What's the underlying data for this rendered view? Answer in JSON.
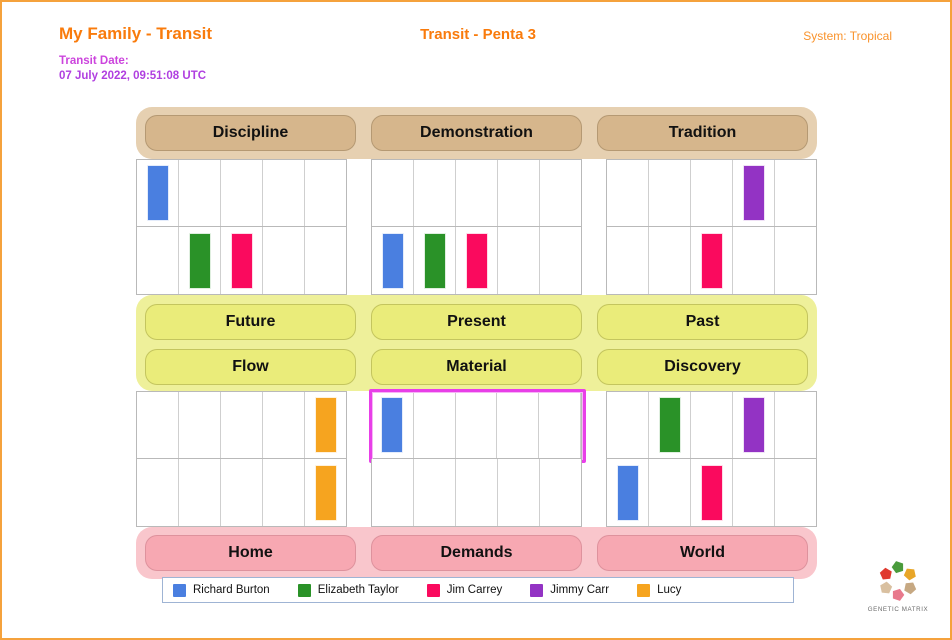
{
  "header": {
    "left_title": "My Family - Transit",
    "center_title": "Transit - Penta 3",
    "system_label": "System: Tropical",
    "transit_date_label": "Transit Date:",
    "transit_date_value": "07 July 2022, 09:51:08 UTC"
  },
  "bands": {
    "top": [
      "Discipline",
      "Demonstration",
      "Tradition"
    ],
    "middle_row1": [
      "Future",
      "Present",
      "Past"
    ],
    "middle_row2": [
      "Flow",
      "Material",
      "Discovery"
    ],
    "bottom": [
      "Home",
      "Demands",
      "World"
    ]
  },
  "people": [
    {
      "name": "Richard Burton",
      "color": "#4a7fe0"
    },
    {
      "name": "Elizabeth Taylor",
      "color": "#2a9228"
    },
    {
      "name": "Jim Carrey",
      "color": "#fa0a5e"
    },
    {
      "name": "Jimmy Carr",
      "color": "#9333c4"
    },
    {
      "name": "Lucy",
      "color": "#f6a41f"
    }
  ],
  "logo": {
    "caption": "GENETIC MATRIX",
    "petal_colors": [
      "#4a9b3c",
      "#e8a628",
      "#c6a882",
      "#e8798c",
      "#d9c0a0",
      "#e03a2f"
    ]
  },
  "chart_data": {
    "type": "bar",
    "title": "Transit - Penta 3",
    "groups": [
      "Discipline",
      "Demonstration",
      "Tradition"
    ],
    "columns_per_group": 5,
    "highlight": {
      "section": "lower",
      "row": 0,
      "group": 1
    },
    "rows": [
      {
        "section": "upper",
        "row": 0,
        "cells": [
          [
            "Richard Burton",
            null,
            null,
            null,
            null
          ],
          [
            null,
            null,
            null,
            null,
            null
          ],
          [
            null,
            null,
            null,
            "Jimmy Carr",
            null
          ]
        ]
      },
      {
        "section": "upper",
        "row": 1,
        "cells": [
          [
            null,
            "Elizabeth Taylor",
            "Jim Carrey",
            null,
            null
          ],
          [
            "Richard Burton",
            "Elizabeth Taylor",
            "Jim Carrey",
            null,
            null
          ],
          [
            null,
            null,
            "Jim Carrey",
            null,
            null
          ]
        ]
      },
      {
        "section": "lower",
        "row": 0,
        "cells": [
          [
            null,
            null,
            null,
            null,
            "Lucy"
          ],
          [
            "Richard Burton",
            null,
            null,
            null,
            null
          ],
          [
            null,
            "Elizabeth Taylor",
            null,
            "Jimmy Carr",
            null
          ]
        ]
      },
      {
        "section": "lower",
        "row": 1,
        "cells": [
          [
            null,
            null,
            null,
            null,
            "Lucy"
          ],
          [
            null,
            null,
            null,
            null,
            null
          ],
          [
            "Richard Burton",
            null,
            "Jim Carrey",
            null,
            null
          ]
        ]
      }
    ]
  }
}
